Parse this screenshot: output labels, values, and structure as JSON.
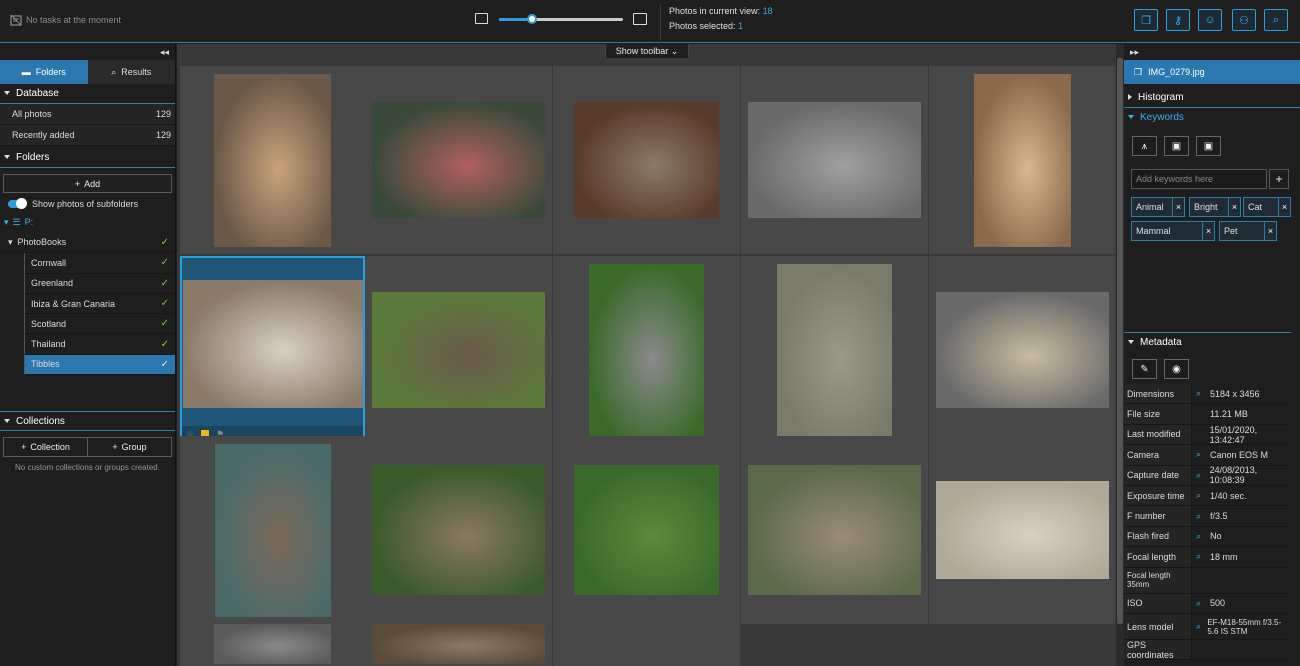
{
  "topbar": {
    "tasks_text": "No tasks at the moment",
    "zoom_level": 0.27,
    "photos_in_view_label": "Photos in current view:",
    "photos_in_view_value": "18",
    "photos_selected_label": "Photos selected:",
    "photos_selected_value": "1",
    "action_icons": [
      "copy-icon",
      "key-icon",
      "face-icon",
      "people-icon",
      "search-icon"
    ]
  },
  "left": {
    "tabs": [
      {
        "label": "Folders",
        "icon": "folder-icon",
        "active": true
      },
      {
        "label": "Results",
        "icon": "search-icon",
        "active": false
      }
    ],
    "database_title": "Database",
    "database_rows": [
      {
        "label": "All photos",
        "count": "129"
      },
      {
        "label": "Recently added",
        "count": "129"
      }
    ],
    "folders_title": "Folders",
    "add_label": "Add",
    "subfolders_toggle": "Show photos of subfolders",
    "drive": "P:",
    "root_folder": "PhotoBooks",
    "folders": [
      "Cornwall",
      "Greenland",
      "Ibiza & Gran Canaria",
      "Scotland",
      "Thailand",
      "Tibbles"
    ],
    "selected_folder": "Tibbles",
    "collections_title": "Collections",
    "collection_btn": "Collection",
    "group_btn": "Group",
    "no_collections": "No custom collections or groups created."
  },
  "center": {
    "show_toolbar": "Show toolbar",
    "selected_index": 5
  },
  "right": {
    "file_name": "IMG_0279.jpg",
    "histogram_title": "Histogram",
    "keywords_title": "Keywords",
    "keyword_placeholder": "Add keywords here",
    "keywords": [
      "Animal",
      "Bright",
      "Cat",
      "Mammal",
      "Pet"
    ],
    "metadata_title": "Metadata",
    "metadata": [
      {
        "k": "Dimensions",
        "v": "5184 x 3456",
        "icon": true
      },
      {
        "k": "File size",
        "v": "11.21 MB",
        "icon": false
      },
      {
        "k": "Last modified",
        "v": "15/01/2020, 13:42:47",
        "icon": false
      },
      {
        "k": "Camera",
        "v": "Canon EOS M",
        "icon": true
      },
      {
        "k": "Capture date",
        "v": "24/08/2013, 10:08:39",
        "icon": true
      },
      {
        "k": "Exposure time",
        "v": "1/40 sec.",
        "icon": true
      },
      {
        "k": "F number",
        "v": "f/3.5",
        "icon": true
      },
      {
        "k": "Flash fired",
        "v": "No",
        "icon": true
      },
      {
        "k": "Focal length",
        "v": "18 mm",
        "icon": true
      },
      {
        "k": "Focal length 35mm",
        "v": "",
        "icon": false
      },
      {
        "k": "ISO",
        "v": "500",
        "icon": true
      },
      {
        "k": "Lens model",
        "v": "EF-M18-55mm f/3.5-5.6 IS STM",
        "icon": true
      },
      {
        "k": "GPS coordinates",
        "v": "",
        "icon": false
      }
    ]
  },
  "colors": {
    "accent": "#2d9ed8",
    "selected_row": "#2a78ad",
    "check": "#6ed04a"
  }
}
